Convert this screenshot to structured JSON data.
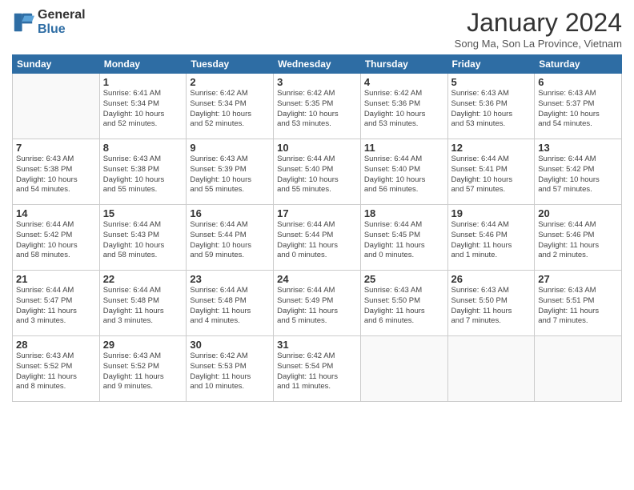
{
  "logo": {
    "general": "General",
    "blue": "Blue"
  },
  "title": "January 2024",
  "subtitle": "Song Ma, Son La Province, Vietnam",
  "headers": [
    "Sunday",
    "Monday",
    "Tuesday",
    "Wednesday",
    "Thursday",
    "Friday",
    "Saturday"
  ],
  "weeks": [
    [
      {
        "day": "",
        "info": ""
      },
      {
        "day": "1",
        "info": "Sunrise: 6:41 AM\nSunset: 5:34 PM\nDaylight: 10 hours\nand 52 minutes."
      },
      {
        "day": "2",
        "info": "Sunrise: 6:42 AM\nSunset: 5:34 PM\nDaylight: 10 hours\nand 52 minutes."
      },
      {
        "day": "3",
        "info": "Sunrise: 6:42 AM\nSunset: 5:35 PM\nDaylight: 10 hours\nand 53 minutes."
      },
      {
        "day": "4",
        "info": "Sunrise: 6:42 AM\nSunset: 5:36 PM\nDaylight: 10 hours\nand 53 minutes."
      },
      {
        "day": "5",
        "info": "Sunrise: 6:43 AM\nSunset: 5:36 PM\nDaylight: 10 hours\nand 53 minutes."
      },
      {
        "day": "6",
        "info": "Sunrise: 6:43 AM\nSunset: 5:37 PM\nDaylight: 10 hours\nand 54 minutes."
      }
    ],
    [
      {
        "day": "7",
        "info": "Sunrise: 6:43 AM\nSunset: 5:38 PM\nDaylight: 10 hours\nand 54 minutes."
      },
      {
        "day": "8",
        "info": "Sunrise: 6:43 AM\nSunset: 5:38 PM\nDaylight: 10 hours\nand 55 minutes."
      },
      {
        "day": "9",
        "info": "Sunrise: 6:43 AM\nSunset: 5:39 PM\nDaylight: 10 hours\nand 55 minutes."
      },
      {
        "day": "10",
        "info": "Sunrise: 6:44 AM\nSunset: 5:40 PM\nDaylight: 10 hours\nand 55 minutes."
      },
      {
        "day": "11",
        "info": "Sunrise: 6:44 AM\nSunset: 5:40 PM\nDaylight: 10 hours\nand 56 minutes."
      },
      {
        "day": "12",
        "info": "Sunrise: 6:44 AM\nSunset: 5:41 PM\nDaylight: 10 hours\nand 57 minutes."
      },
      {
        "day": "13",
        "info": "Sunrise: 6:44 AM\nSunset: 5:42 PM\nDaylight: 10 hours\nand 57 minutes."
      }
    ],
    [
      {
        "day": "14",
        "info": "Sunrise: 6:44 AM\nSunset: 5:42 PM\nDaylight: 10 hours\nand 58 minutes."
      },
      {
        "day": "15",
        "info": "Sunrise: 6:44 AM\nSunset: 5:43 PM\nDaylight: 10 hours\nand 58 minutes."
      },
      {
        "day": "16",
        "info": "Sunrise: 6:44 AM\nSunset: 5:44 PM\nDaylight: 10 hours\nand 59 minutes."
      },
      {
        "day": "17",
        "info": "Sunrise: 6:44 AM\nSunset: 5:44 PM\nDaylight: 11 hours\nand 0 minutes."
      },
      {
        "day": "18",
        "info": "Sunrise: 6:44 AM\nSunset: 5:45 PM\nDaylight: 11 hours\nand 0 minutes."
      },
      {
        "day": "19",
        "info": "Sunrise: 6:44 AM\nSunset: 5:46 PM\nDaylight: 11 hours\nand 1 minute."
      },
      {
        "day": "20",
        "info": "Sunrise: 6:44 AM\nSunset: 5:46 PM\nDaylight: 11 hours\nand 2 minutes."
      }
    ],
    [
      {
        "day": "21",
        "info": "Sunrise: 6:44 AM\nSunset: 5:47 PM\nDaylight: 11 hours\nand 3 minutes."
      },
      {
        "day": "22",
        "info": "Sunrise: 6:44 AM\nSunset: 5:48 PM\nDaylight: 11 hours\nand 3 minutes."
      },
      {
        "day": "23",
        "info": "Sunrise: 6:44 AM\nSunset: 5:48 PM\nDaylight: 11 hours\nand 4 minutes."
      },
      {
        "day": "24",
        "info": "Sunrise: 6:44 AM\nSunset: 5:49 PM\nDaylight: 11 hours\nand 5 minutes."
      },
      {
        "day": "25",
        "info": "Sunrise: 6:43 AM\nSunset: 5:50 PM\nDaylight: 11 hours\nand 6 minutes."
      },
      {
        "day": "26",
        "info": "Sunrise: 6:43 AM\nSunset: 5:50 PM\nDaylight: 11 hours\nand 7 minutes."
      },
      {
        "day": "27",
        "info": "Sunrise: 6:43 AM\nSunset: 5:51 PM\nDaylight: 11 hours\nand 7 minutes."
      }
    ],
    [
      {
        "day": "28",
        "info": "Sunrise: 6:43 AM\nSunset: 5:52 PM\nDaylight: 11 hours\nand 8 minutes."
      },
      {
        "day": "29",
        "info": "Sunrise: 6:43 AM\nSunset: 5:52 PM\nDaylight: 11 hours\nand 9 minutes."
      },
      {
        "day": "30",
        "info": "Sunrise: 6:42 AM\nSunset: 5:53 PM\nDaylight: 11 hours\nand 10 minutes."
      },
      {
        "day": "31",
        "info": "Sunrise: 6:42 AM\nSunset: 5:54 PM\nDaylight: 11 hours\nand 11 minutes."
      },
      {
        "day": "",
        "info": ""
      },
      {
        "day": "",
        "info": ""
      },
      {
        "day": "",
        "info": ""
      }
    ]
  ]
}
